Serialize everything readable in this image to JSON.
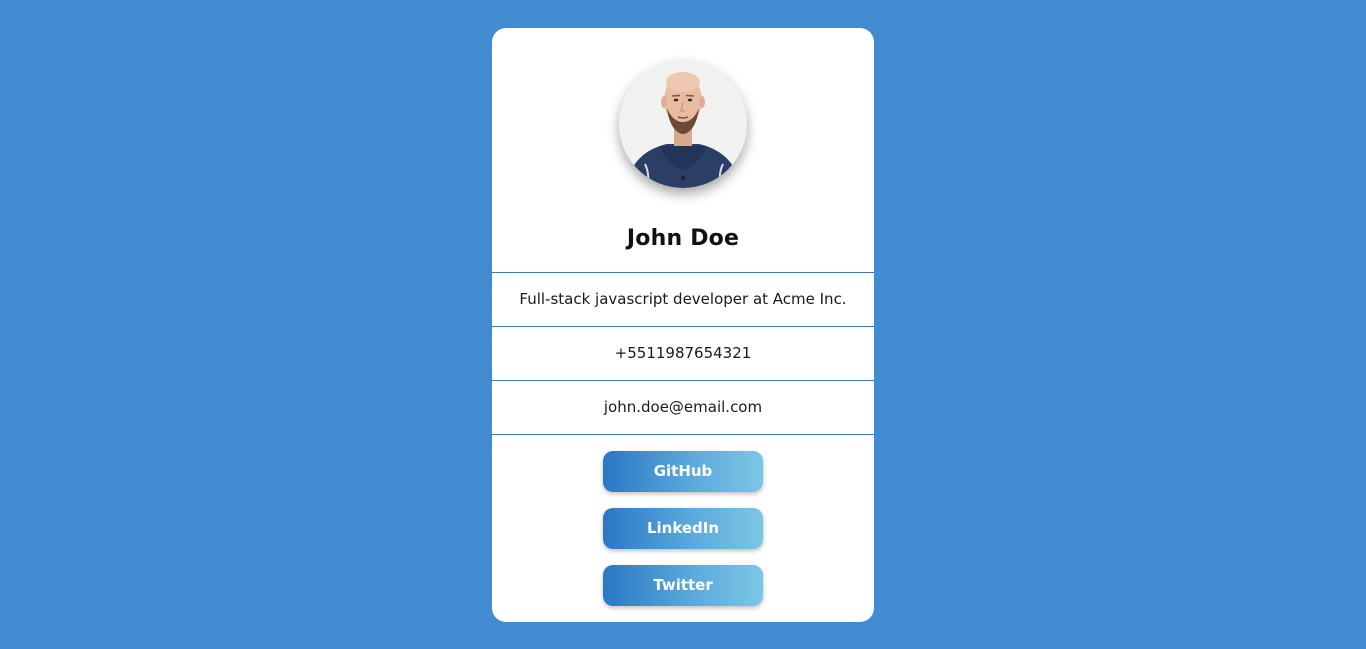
{
  "profile": {
    "name": "John Doe",
    "bio": "Full-stack javascript developer at Acme Inc.",
    "phone": "+5511987654321",
    "email": "john.doe@email.com"
  },
  "links": {
    "github_label": "GitHub",
    "linkedin_label": "LinkedIn",
    "twitter_label": "Twitter"
  },
  "colors": {
    "page_background": "#438bd0",
    "card_background": "#ffffff",
    "divider": "#3d79b8",
    "button_gradient_start": "#2a77c4",
    "button_gradient_end": "#7cc6e6"
  },
  "icons": {
    "avatar": "profile-photo"
  }
}
